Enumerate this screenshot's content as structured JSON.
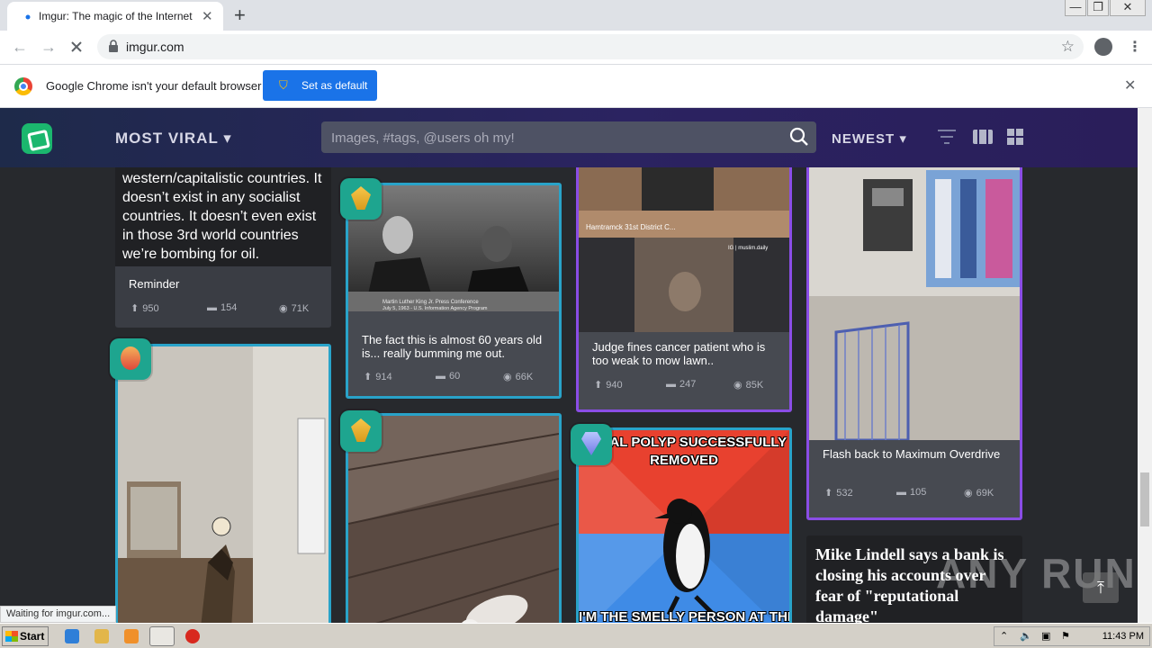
{
  "browser": {
    "tab_title": "Imgur: The magic of the Internet",
    "new_tab": "+",
    "tab_close": "✕",
    "url": "imgur.com",
    "win_min": "—",
    "win_max": "❐",
    "win_close": "✕"
  },
  "infobar": {
    "message": "Google Chrome isn't your default browser",
    "button": "Set as default",
    "close": "✕"
  },
  "header": {
    "section": "MOST VIRAL",
    "search_placeholder": "Images, #tags, @users oh my!",
    "sort": "NEWEST"
  },
  "posts": {
    "p1": {
      "text": "western/capitalistic countries. It doesn’t exist in any socialist countries. It doesn’t even exist in those 3rd world countries we’re bombing for oil.",
      "title": "Reminder",
      "up": "950",
      "comments": "154",
      "views": "71K"
    },
    "p2": {
      "title": "The fact this is almost 60 years old is... really bumming me out.",
      "up": "914",
      "comments": "60",
      "views": "66K"
    },
    "p3": {
      "title": "Judge fines cancer patient who is too weak to mow lawn..",
      "up": "940",
      "comments": "247",
      "views": "85K",
      "image_text_1": "Hamtramck 31st District C...",
      "image_text_2": "IG | muslim.daily"
    },
    "p4": {
      "title": "Flash back to Maximum Overdrive",
      "up": "532",
      "comments": "105",
      "views": "69K"
    },
    "p5": {
      "meme_top": "NASAL POLYP SUCCESSFULLY REMOVED",
      "meme_bottom": "I'M THE SMELLY PERSON AT THE"
    },
    "p6": {
      "title": "Mike Lindell says a bank is closing his accounts over fear of \"reputational damage\""
    },
    "p2_caption_1": "Martin Luther King Jr. Press Conference",
    "p2_caption_2": "July 5, 1963 - U.S. Information Agency Program"
  },
  "status": "Waiting for imgur.com...",
  "watermark": "ANY RUN",
  "taskbar": {
    "start": "Start",
    "clock": "11:43 PM"
  },
  "colors": {
    "teal_border": "#29a3c9",
    "purple_border": "#8a4de6",
    "header": "#2b2361",
    "infobar_button": "#1a73e8"
  }
}
